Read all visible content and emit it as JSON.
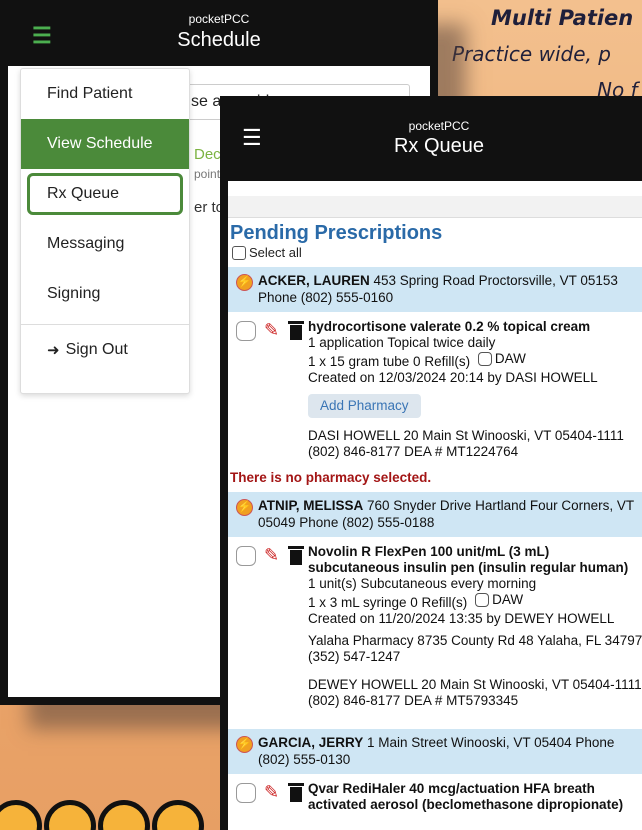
{
  "background": {
    "title": "Multi Patien",
    "line1": "Practice wide, p",
    "line2": "No f"
  },
  "colors": {
    "accent_green": "#4b8a3a",
    "title_blue": "#2a6aa8",
    "warning_red": "#a31515",
    "patient_band": "#cfe6f4"
  },
  "schedule_screen": {
    "brand": "pocketPCC",
    "title": "Schedule",
    "provider_select": "se a provider",
    "date_fragment": "Dec",
    "sub_fragment": "point",
    "note_fragment": "er to",
    "menu": {
      "items": [
        "Find Patient",
        "View Schedule",
        "Rx Queue",
        "Messaging",
        "Signing"
      ],
      "sign_out": "Sign Out"
    }
  },
  "rx_screen": {
    "brand": "pocketPCC",
    "title": "Rx Queue",
    "section_title": "Pending Prescriptions",
    "select_all": "Select all",
    "no_pharmacy_warning": "There is no pharmacy selected.",
    "patients": [
      {
        "name": "ACKER, LAUREN",
        "details": " 453 Spring Road Proctorsville, VT 05153 Phone (802) 555-0160",
        "rx": {
          "drug": "hydrocortisone valerate 0.2 % topical cream",
          "sig": "1 application Topical twice daily",
          "qty": "1 x 15 gram tube 0 Refill(s)",
          "daw": "DAW",
          "created": "Created on 12/03/2024 20:14 by DASI HOWELL",
          "add_pharmacy": "Add Pharmacy",
          "prescriber": "DASI HOWELL 20 Main St Winooski, VT 05404-1111 (802) 846-8177 DEA # MT1224764"
        }
      },
      {
        "name": "ATNIP, MELISSA",
        "details": " 760 Snyder Drive Hartland Four Corners, VT 05049 Phone (802) 555-0188",
        "rx": {
          "drug": "Novolin R FlexPen 100 unit/mL (3 mL) subcutaneous insulin pen (insulin regular human)",
          "sig": "1 unit(s) Subcutaneous every morning",
          "qty": "1 x 3 mL syringe 0 Refill(s)",
          "daw": "DAW",
          "created": "Created on 11/20/2024 13:35 by DEWEY HOWELL",
          "pharmacy": "Yalaha Pharmacy 8735 County Rd 48 Yalaha, FL 34797 (352) 547-1247",
          "prescriber": "DEWEY HOWELL 20 Main St Winooski, VT 05404-1111 (802) 846-8177 DEA # MT5793345"
        }
      },
      {
        "name": "GARCIA, JERRY",
        "details": " 1 Main Street Winooski, VT 05404 Phone (802) 555-0130",
        "rx": {
          "drug": "Qvar RediHaler 40 mcg/actuation HFA breath activated aerosol (beclomethasone dipropionate)"
        }
      }
    ]
  }
}
